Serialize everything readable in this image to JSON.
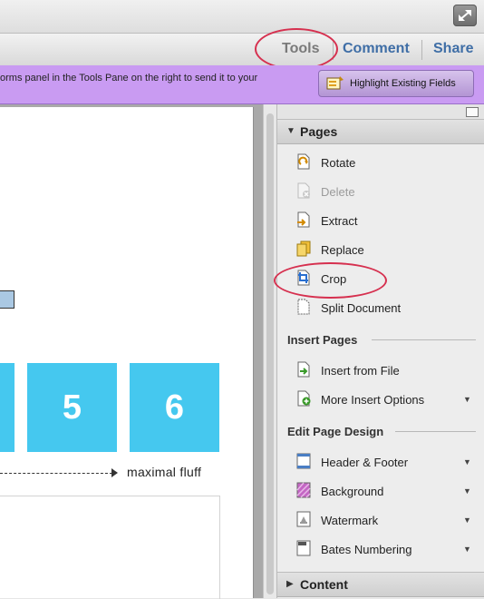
{
  "toolbar": {
    "tools_label": "Tools",
    "comment_label": "Comment",
    "share_label": "Share"
  },
  "formbar": {
    "message": "orms panel in the Tools Pane on the right to send it to your",
    "highlight_button": "Highlight Existing Fields"
  },
  "document": {
    "tiles": [
      "5",
      "6"
    ],
    "caption": "maximal fluff"
  },
  "pane": {
    "pages_section": "Pages",
    "pages_items": [
      {
        "label": "Rotate",
        "icon": "rotate-icon"
      },
      {
        "label": "Delete",
        "icon": "delete-icon",
        "disabled": true
      },
      {
        "label": "Extract",
        "icon": "extract-icon"
      },
      {
        "label": "Replace",
        "icon": "replace-icon"
      },
      {
        "label": "Crop",
        "icon": "crop-icon"
      },
      {
        "label": "Split Document",
        "icon": "split-icon"
      }
    ],
    "insert_group": "Insert Pages",
    "insert_items": [
      {
        "label": "Insert from File",
        "icon": "insert-file-icon"
      },
      {
        "label": "More Insert Options",
        "icon": "insert-options-icon"
      }
    ],
    "design_group": "Edit Page Design",
    "design_items": [
      {
        "label": "Header & Footer",
        "icon": "header-footer-icon"
      },
      {
        "label": "Background",
        "icon": "background-icon"
      },
      {
        "label": "Watermark",
        "icon": "watermark-icon"
      },
      {
        "label": "Bates Numbering",
        "icon": "bates-icon"
      }
    ],
    "content_section": "Content"
  },
  "colors": {
    "accent_link": "#3f6ea6",
    "form_bar": "#c99bf2",
    "tile": "#45c8ef",
    "annotation_ring": "#d6304f"
  }
}
